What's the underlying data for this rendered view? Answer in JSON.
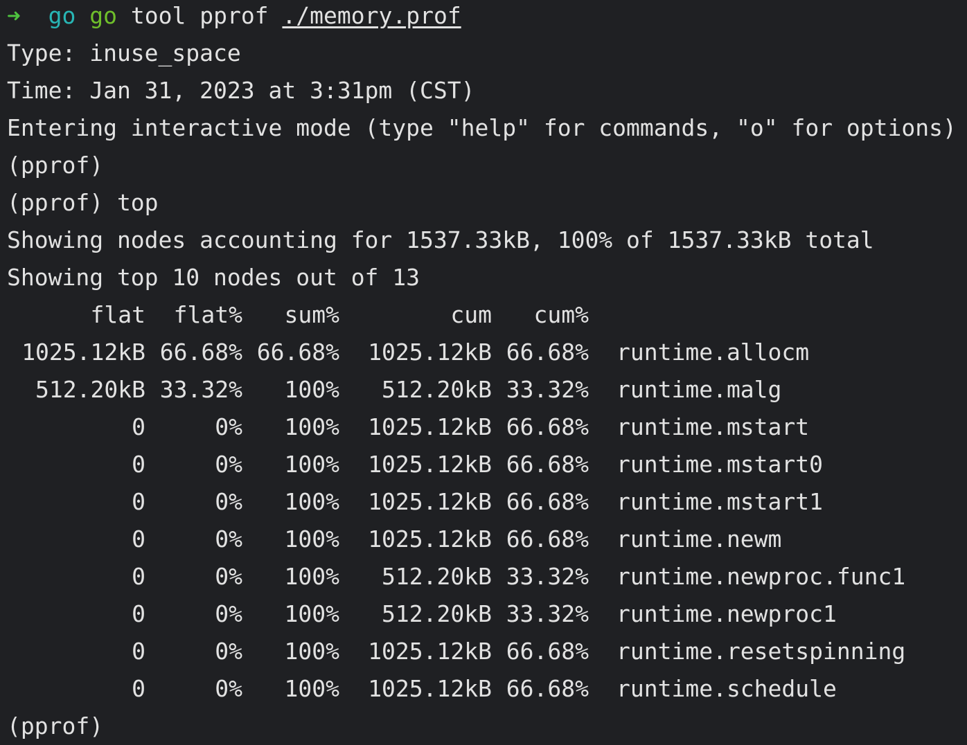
{
  "prompt": {
    "arrow": "➜",
    "cwd": "go",
    "command": "go",
    "args": "tool pprof",
    "file": "./memory.prof"
  },
  "header_lines": [
    "Type: inuse_space",
    "Time: Jan 31, 2023 at 3:31pm (CST)",
    "Entering interactive mode (type \"help\" for commands, \"o\" for options)",
    "(pprof)",
    "(pprof) top",
    "Showing nodes accounting for 1537.33kB, 100% of 1537.33kB total",
    "Showing top 10 nodes out of 13"
  ],
  "table": {
    "columns": [
      "flat",
      "flat%",
      "sum%",
      "cum",
      "cum%"
    ],
    "rows": [
      {
        "flat": "1025.12kB",
        "flat_pct": "66.68%",
        "sum_pct": "66.68%",
        "cum": "1025.12kB",
        "cum_pct": "66.68%",
        "name": "runtime.allocm"
      },
      {
        "flat": "512.20kB",
        "flat_pct": "33.32%",
        "sum_pct": "100%",
        "cum": "512.20kB",
        "cum_pct": "33.32%",
        "name": "runtime.malg"
      },
      {
        "flat": "0",
        "flat_pct": "0%",
        "sum_pct": "100%",
        "cum": "1025.12kB",
        "cum_pct": "66.68%",
        "name": "runtime.mstart"
      },
      {
        "flat": "0",
        "flat_pct": "0%",
        "sum_pct": "100%",
        "cum": "1025.12kB",
        "cum_pct": "66.68%",
        "name": "runtime.mstart0"
      },
      {
        "flat": "0",
        "flat_pct": "0%",
        "sum_pct": "100%",
        "cum": "1025.12kB",
        "cum_pct": "66.68%",
        "name": "runtime.mstart1"
      },
      {
        "flat": "0",
        "flat_pct": "0%",
        "sum_pct": "100%",
        "cum": "1025.12kB",
        "cum_pct": "66.68%",
        "name": "runtime.newm"
      },
      {
        "flat": "0",
        "flat_pct": "0%",
        "sum_pct": "100%",
        "cum": "512.20kB",
        "cum_pct": "33.32%",
        "name": "runtime.newproc.func1"
      },
      {
        "flat": "0",
        "flat_pct": "0%",
        "sum_pct": "100%",
        "cum": "512.20kB",
        "cum_pct": "33.32%",
        "name": "runtime.newproc1"
      },
      {
        "flat": "0",
        "flat_pct": "0%",
        "sum_pct": "100%",
        "cum": "1025.12kB",
        "cum_pct": "66.68%",
        "name": "runtime.resetspinning"
      },
      {
        "flat": "0",
        "flat_pct": "0%",
        "sum_pct": "100%",
        "cum": "1025.12kB",
        "cum_pct": "66.68%",
        "name": "runtime.schedule"
      }
    ]
  },
  "final_prompt": "(pprof)",
  "colors": {
    "background": "#1f2023",
    "foreground": "#e2e2e2",
    "arrow": "#4ec23f",
    "cwd": "#28b6b5",
    "command": "#6fbf2b"
  }
}
